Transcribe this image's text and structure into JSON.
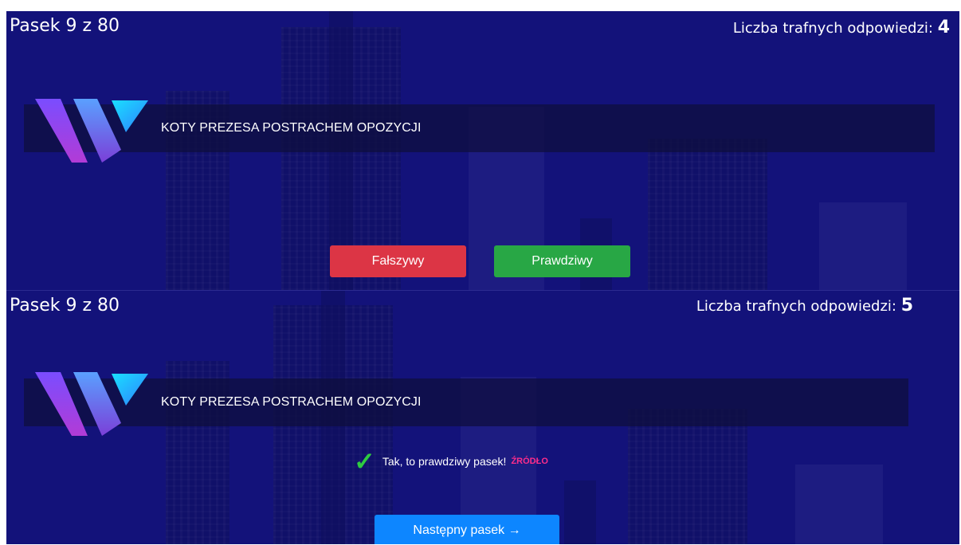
{
  "screen_before": {
    "counter": "Pasek 9 z 80",
    "score_label": "Liczba trafnych odpowiedzi:",
    "score_value": "4",
    "headline": "KOTY PREZESA POSTRACHEM OPOZYCJI",
    "false_button": "Fałszywy",
    "true_button": "Prawdziwy"
  },
  "screen_after": {
    "counter": "Pasek 9 z 80",
    "score_label": "Liczba trafnych odpowiedzi:",
    "score_value": "5",
    "headline": "KOTY PREZESA POSTRACHEM OPOZYCJI",
    "check_icon": "✓",
    "feedback_text": "Tak, to prawdziwy pasek!",
    "source_link": "ŹRÓDŁO",
    "next_button": "Następny pasek →"
  },
  "colors": {
    "background": "#13127a",
    "false": "#dc3545",
    "true": "#28a745",
    "next": "#0d86ff",
    "source": "#ff2d8a",
    "check": "#2ecc40"
  }
}
